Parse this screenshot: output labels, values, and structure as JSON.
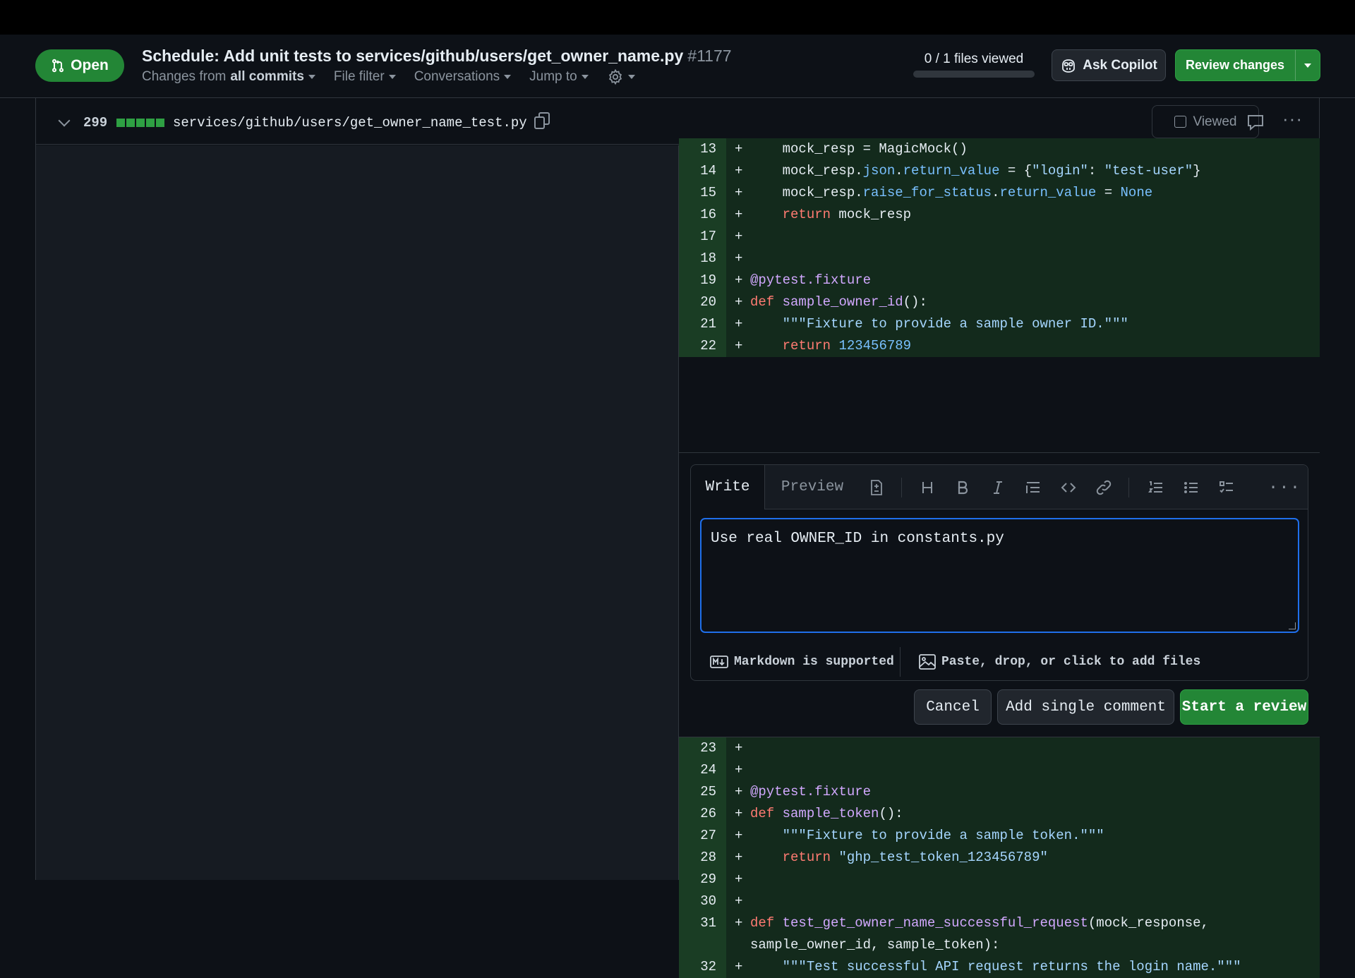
{
  "pr": {
    "status": "Open",
    "title": "Schedule: Add unit tests to services/github/users/get_owner_name.py",
    "number": "#1177",
    "changes_from_prefix": "Changes from",
    "changes_from_value": "all commits",
    "file_filter": "File filter",
    "conversations": "Conversations",
    "jump_to": "Jump to",
    "files_viewed": "0 / 1 files viewed",
    "files_viewed_fraction": 0,
    "ask_copilot": "Ask Copilot",
    "review_changes": "Review changes"
  },
  "file": {
    "lines_changed": "299",
    "path": "services/github/users/get_owner_name_test.py",
    "viewed_label": "Viewed",
    "viewed_checked": false
  },
  "code_top": [
    {
      "ln": "13",
      "sign": "+",
      "html": "    mock_resp = MagicMock()"
    },
    {
      "ln": "14",
      "sign": "+",
      "html": "    mock_resp.<span class=\"attr\">json</span>.<span class=\"attr\">return_value</span> = {<span class=\"str\">\"login\"</span>: <span class=\"str\">\"test-user\"</span>}"
    },
    {
      "ln": "15",
      "sign": "+",
      "html": "    mock_resp.<span class=\"attr\">raise_for_status</span>.<span class=\"attr\">return_value</span> = <span class=\"num\">None</span>"
    },
    {
      "ln": "16",
      "sign": "+",
      "html": "    <span class=\"kw\">return</span> mock_resp"
    },
    {
      "ln": "17",
      "sign": "+",
      "html": ""
    },
    {
      "ln": "18",
      "sign": "+",
      "html": ""
    },
    {
      "ln": "19",
      "sign": "+",
      "html": "<span class=\"deco\">@pytest.fixture</span>"
    },
    {
      "ln": "20",
      "sign": "+",
      "html": "<span class=\"kw\">def</span> <span class=\"fn\">sample_owner_id</span>():"
    },
    {
      "ln": "21",
      "sign": "+",
      "html": "    <span class=\"str\">\"\"\"Fixture to provide a sample owner ID.\"\"\"</span>"
    },
    {
      "ln": "22",
      "sign": "+",
      "html": "    <span class=\"kw\">return</span> <span class=\"num\">123456789</span>"
    }
  ],
  "comment": {
    "tab_write": "Write",
    "tab_preview": "Preview",
    "text": "Use real OWNER_ID in constants.py",
    "markdown_note": "Markdown is supported",
    "attach_note": "Paste, drop, or click to add files",
    "cancel": "Cancel",
    "add_single": "Add single comment",
    "start_review": "Start a review"
  },
  "code_bottom": [
    {
      "ln": "23",
      "sign": "+",
      "html": ""
    },
    {
      "ln": "24",
      "sign": "+",
      "html": ""
    },
    {
      "ln": "25",
      "sign": "+",
      "html": "<span class=\"deco\">@pytest.fixture</span>"
    },
    {
      "ln": "26",
      "sign": "+",
      "html": "<span class=\"kw\">def</span> <span class=\"fn\">sample_token</span>():"
    },
    {
      "ln": "27",
      "sign": "+",
      "html": "    <span class=\"str\">\"\"\"Fixture to provide a sample token.\"\"\"</span>"
    },
    {
      "ln": "28",
      "sign": "+",
      "html": "    <span class=\"kw\">return</span> <span class=\"str\">\"ghp_test_token_123456789\"</span>"
    },
    {
      "ln": "29",
      "sign": "+",
      "html": ""
    },
    {
      "ln": "30",
      "sign": "+",
      "html": ""
    },
    {
      "ln": "31",
      "sign": "+",
      "html": "<span class=\"kw\">def</span> <span class=\"fn\">test_get_owner_name_successful_request</span>(mock_response,"
    },
    {
      "ln": "",
      "sign": "",
      "html": "sample_owner_id, sample_token):"
    },
    {
      "ln": "32",
      "sign": "+",
      "html": "    <span class=\"str\">\"\"\"Test successful API request returns the login name.\"\"\"</span>"
    }
  ],
  "colors": {
    "accent_green": "#238636",
    "focus_blue": "#1f6feb",
    "added_line_bg": "#132a1c",
    "added_gutter_bg": "#1a3d24"
  }
}
